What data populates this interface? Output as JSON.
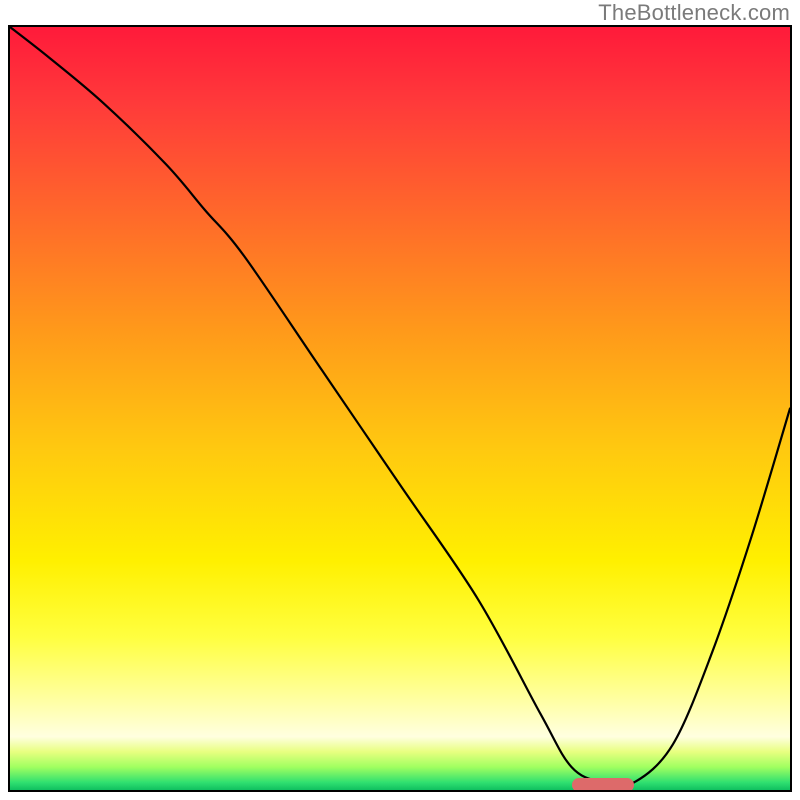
{
  "watermark": "TheBottleneck.com",
  "chart_data": {
    "type": "line",
    "title": "",
    "xlabel": "",
    "ylabel": "",
    "xlim": [
      0,
      100
    ],
    "ylim": [
      0,
      100
    ],
    "x": [
      0,
      5,
      12,
      20,
      25,
      30,
      40,
      50,
      60,
      68,
      72,
      76,
      80,
      85,
      90,
      95,
      100
    ],
    "y": [
      100,
      96,
      90,
      82,
      76,
      70,
      55,
      40,
      25,
      10,
      3,
      1,
      1,
      6,
      18,
      33,
      50
    ],
    "marker": {
      "x_start": 72,
      "x_end": 80,
      "y": 0.6
    },
    "gradient_stops": [
      {
        "pos": 0,
        "color": "#ff1a3a"
      },
      {
        "pos": 25,
        "color": "#ff6a2a"
      },
      {
        "pos": 55,
        "color": "#ffc810"
      },
      {
        "pos": 80,
        "color": "#ffff40"
      },
      {
        "pos": 97,
        "color": "#a0ff60"
      },
      {
        "pos": 100,
        "color": "#10c060"
      }
    ]
  }
}
